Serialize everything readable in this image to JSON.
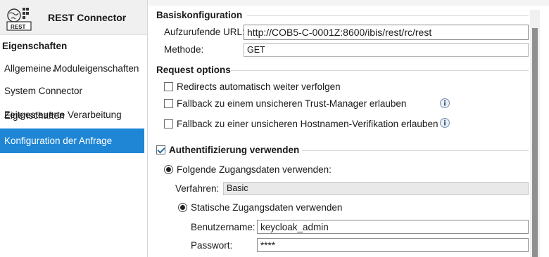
{
  "header": {
    "title": "REST Connector",
    "logo_text": "REST"
  },
  "sidebar": {
    "section_label": "Eigenschaften",
    "items": [
      {
        "label": "Allgemeine Moduleigenschaften",
        "active": false
      },
      {
        "label": "System Connector Eigenschaften",
        "active": false
      },
      {
        "label": "Zeitgesteuerte Verarbeitung",
        "active": false
      },
      {
        "label": "Konfiguration der Anfrage",
        "active": true
      }
    ]
  },
  "basis": {
    "title": "Basiskonfiguration",
    "url_label": "Aufzurufende URL:",
    "url_value": "http://COB5-C-0001Z:8600/ibis/rest/rc/rest",
    "method_label": "Methode:",
    "method_value": "GET"
  },
  "request": {
    "title": "Request options",
    "options": [
      {
        "label": "Redirects automatisch weiter verfolgen",
        "checked": false,
        "info": false
      },
      {
        "label": "Fallback zu einem unsicheren Trust-Manager erlauben",
        "checked": false,
        "info": true
      },
      {
        "label": "Fallback zu einer unsicheren Hostnamen-Verifikation erlauben",
        "checked": false,
        "info": true
      }
    ]
  },
  "auth": {
    "label": "Authentifizierung verwenden",
    "checked": true,
    "radio_label": "Folgende Zugangsdaten verwenden:",
    "method_label": "Verfahren:",
    "method_value": "Basic",
    "static_label": "Statische Zugangsdaten verwenden",
    "user_label": "Benutzername:",
    "user_value": "keycloak_admin",
    "password_label": "Passwort:",
    "password_value": "****"
  },
  "colors": {
    "active_nav": "#1f86d6",
    "accent": "#2b6fb0"
  }
}
